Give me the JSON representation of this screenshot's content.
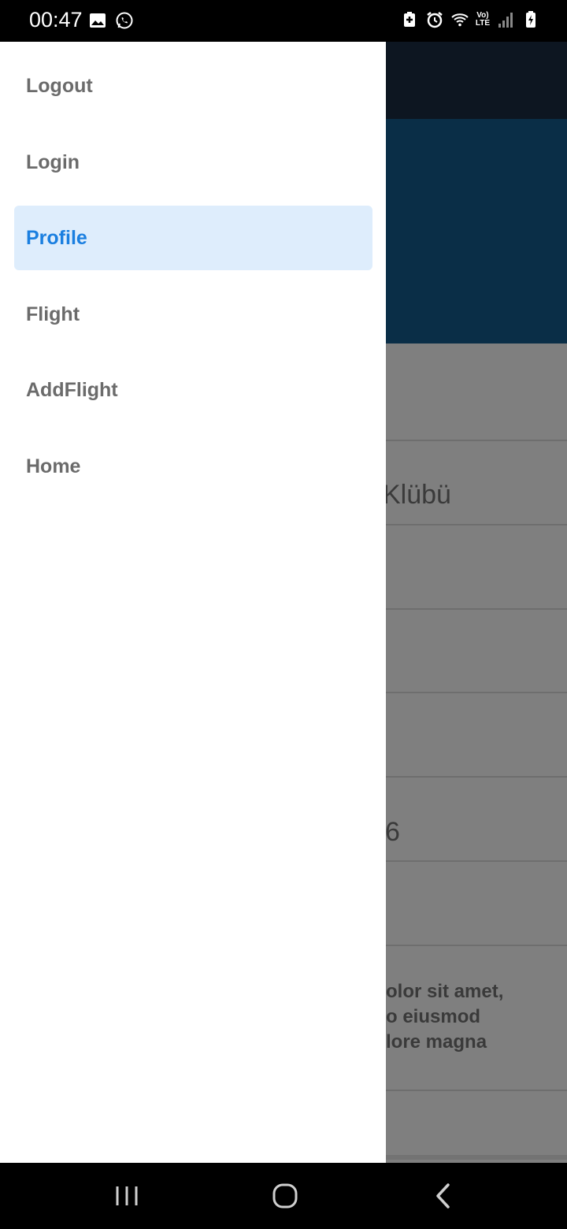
{
  "status_bar": {
    "time": "00:47",
    "left_icons": [
      "image-icon",
      "whatsapp-icon"
    ],
    "right_icons": [
      "battery-saver-icon",
      "alarm-icon",
      "wifi-icon",
      "volte-icon",
      "signal-icon",
      "battery-icon"
    ],
    "volte_text": "Vo)\nLTE"
  },
  "drawer": {
    "items": [
      {
        "label": "Logout",
        "active": false
      },
      {
        "label": "Login",
        "active": false
      },
      {
        "label": "Profile",
        "active": true
      },
      {
        "label": "Flight",
        "active": false
      },
      {
        "label": "AddFlight",
        "active": false
      },
      {
        "label": "Home",
        "active": false
      }
    ]
  },
  "background_app": {
    "club_text": "Klübü",
    "number_text": "6",
    "paragraph_lines": [
      "olor sit amet,",
      "o eiusmod",
      "lore magna"
    ]
  },
  "nav_bar": {
    "buttons": [
      "recent-apps-icon",
      "home-icon",
      "back-icon"
    ]
  },
  "colors": {
    "drawer_active_bg": "#deedfc",
    "drawer_active_text": "#1a7fe0",
    "drawer_text": "#6b6b6b",
    "toolbar_bg": "#0d1621",
    "header_bg": "#0a2e47",
    "scrim": "#7f7f7f"
  }
}
